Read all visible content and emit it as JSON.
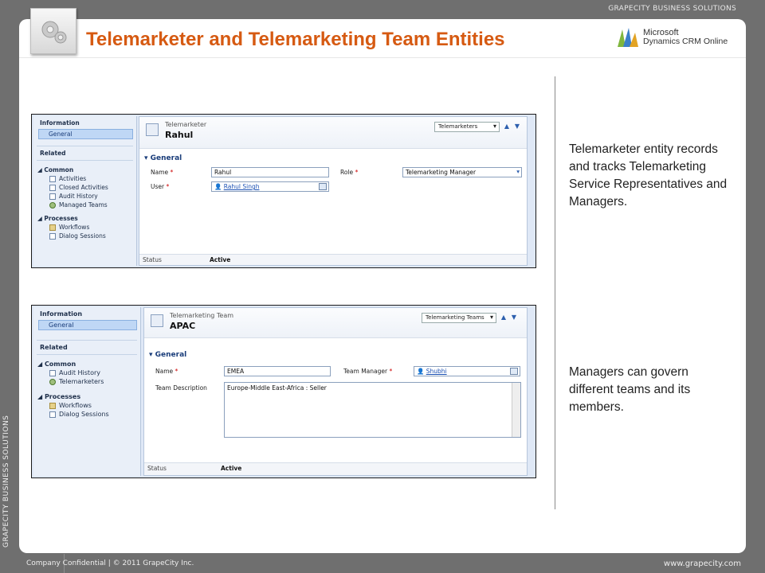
{
  "brand_top": "GRAPECITY BUSINESS SOLUTIONS",
  "brand_side": "GRAPECITY BUSINESS SOLUTIONS",
  "title": "Telemarketer and Telemarketing Team Entities",
  "logo": {
    "line1": "Microsoft",
    "line2": "Dynamics CRM Online"
  },
  "description1": "Telemarketer entity records and tracks Telemarketing Service Representatives and Managers.",
  "description2": "Managers can govern different teams and its members.",
  "footer": {
    "left": "Company Confidential  |  © 2011 GrapeCity Inc.",
    "right": "www.grapecity.com"
  },
  "form1": {
    "nav": {
      "information": "Information",
      "general": "General",
      "related": "Related",
      "common": "Common",
      "common_items": [
        "Activities",
        "Closed Activities",
        "Audit History",
        "Managed Teams"
      ],
      "processes": "Processes",
      "process_items": [
        "Workflows",
        "Dialog Sessions"
      ]
    },
    "entity_type": "Telemarketer",
    "record_name": "Rahul",
    "view_selector": "Telemarketers",
    "section": "General",
    "name_label": "Name",
    "name_value": "Rahul",
    "role_label": "Role",
    "role_value": "Telemarketing Manager",
    "user_label": "User",
    "user_value": "Rahul Singh",
    "status_label": "Status",
    "status_value": "Active"
  },
  "form2": {
    "nav": {
      "information": "Information",
      "general": "General",
      "related": "Related",
      "common": "Common",
      "common_items": [
        "Audit History",
        "Telemarketers"
      ],
      "processes": "Processes",
      "process_items": [
        "Workflows",
        "Dialog Sessions"
      ]
    },
    "entity_type": "Telemarketing Team",
    "record_name": "APAC",
    "view_selector": "Telemarketing Teams",
    "section": "General",
    "name_label": "Name",
    "name_value": "EMEA",
    "manager_label": "Team Manager",
    "manager_value": "Shubhi",
    "description_label": "Team Description",
    "description_value": "Europe-Middle East-Africa : Seller",
    "status_label": "Status",
    "status_value": "Active"
  }
}
